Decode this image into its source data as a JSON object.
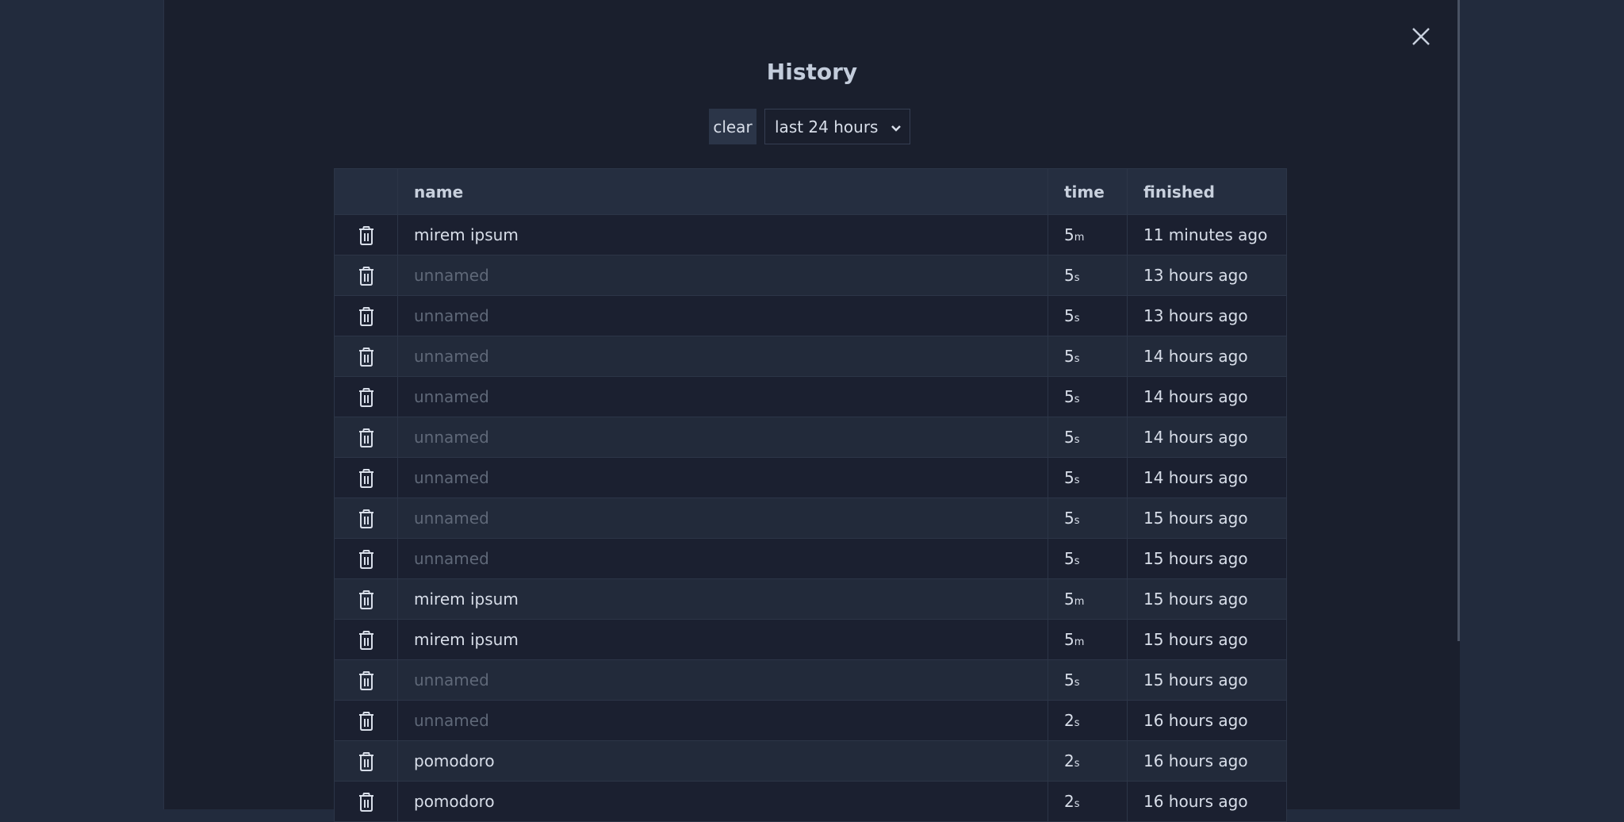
{
  "modal": {
    "title": "History",
    "clear_label": "clear",
    "range": {
      "selected": "last 24 hours"
    }
  },
  "table": {
    "headers": {
      "name": "name",
      "time": "time",
      "finished": "finished"
    },
    "rows": [
      {
        "name": "mirem ipsum",
        "named": true,
        "time_value": "5",
        "time_unit": "m",
        "finished": "11 minutes ago"
      },
      {
        "name": "unnamed",
        "named": false,
        "time_value": "5",
        "time_unit": "s",
        "finished": "13 hours ago"
      },
      {
        "name": "unnamed",
        "named": false,
        "time_value": "5",
        "time_unit": "s",
        "finished": "13 hours ago"
      },
      {
        "name": "unnamed",
        "named": false,
        "time_value": "5",
        "time_unit": "s",
        "finished": "14 hours ago"
      },
      {
        "name": "unnamed",
        "named": false,
        "time_value": "5",
        "time_unit": "s",
        "finished": "14 hours ago"
      },
      {
        "name": "unnamed",
        "named": false,
        "time_value": "5",
        "time_unit": "s",
        "finished": "14 hours ago"
      },
      {
        "name": "unnamed",
        "named": false,
        "time_value": "5",
        "time_unit": "s",
        "finished": "14 hours ago"
      },
      {
        "name": "unnamed",
        "named": false,
        "time_value": "5",
        "time_unit": "s",
        "finished": "15 hours ago"
      },
      {
        "name": "unnamed",
        "named": false,
        "time_value": "5",
        "time_unit": "s",
        "finished": "15 hours ago"
      },
      {
        "name": "mirem ipsum",
        "named": true,
        "time_value": "5",
        "time_unit": "m",
        "finished": "15 hours ago"
      },
      {
        "name": "mirem ipsum",
        "named": true,
        "time_value": "5",
        "time_unit": "m",
        "finished": "15 hours ago"
      },
      {
        "name": "unnamed",
        "named": false,
        "time_value": "5",
        "time_unit": "s",
        "finished": "15 hours ago"
      },
      {
        "name": "unnamed",
        "named": false,
        "time_value": "2",
        "time_unit": "s",
        "finished": "16 hours ago"
      },
      {
        "name": "pomodoro",
        "named": true,
        "time_value": "2",
        "time_unit": "s",
        "finished": "16 hours ago"
      },
      {
        "name": "pomodoro",
        "named": true,
        "time_value": "2",
        "time_unit": "s",
        "finished": "16 hours ago"
      }
    ]
  },
  "icons": {
    "close": "close-icon",
    "delete": "trash-icon",
    "dropdown": "chevron-down-icon"
  }
}
